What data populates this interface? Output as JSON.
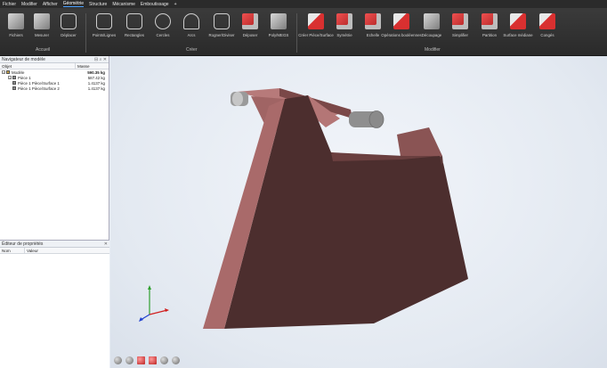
{
  "menu": {
    "items": [
      "Fichier",
      "Modifier",
      "Afficher",
      "Géométrie",
      "Structure",
      "Mécanisme",
      "Emboutissage",
      "+"
    ],
    "active": "Géométrie"
  },
  "ribbon": {
    "groups": {
      "accueil": "Accueil",
      "creer": "Créer",
      "modifier": "Modifier"
    },
    "buttons": [
      {
        "label": "Fichiers",
        "icon": "files-icon"
      },
      {
        "label": "Mesurer",
        "icon": "measure-icon"
      },
      {
        "label": "Déplacer",
        "icon": "move-icon"
      },
      {
        "label": "Points/Lignes",
        "icon": "points-lines-icon"
      },
      {
        "label": "Rectangles",
        "icon": "rectangles-icon"
      },
      {
        "label": "Cercles",
        "icon": "circles-icon"
      },
      {
        "label": "Arcs",
        "icon": "arcs-icon"
      },
      {
        "label": "Rogner/Diviser",
        "icon": "trim-split-icon"
      },
      {
        "label": "Déposer",
        "icon": "deposit-icon"
      },
      {
        "label": "Poly/MEGS",
        "icon": "poly-icon"
      },
      {
        "label": "Créer Pièce/Surface",
        "icon": "create-part-icon"
      },
      {
        "label": "Symétrie",
        "icon": "symmetry-icon"
      },
      {
        "label": "Echelle",
        "icon": "scale-icon"
      },
      {
        "label": "Opérations booléennes",
        "icon": "boolean-icon"
      },
      {
        "label": "Découpage",
        "icon": "cut-icon"
      },
      {
        "label": "Simplifier",
        "icon": "simplify-icon"
      },
      {
        "label": "Partition",
        "icon": "partition-icon"
      },
      {
        "label": "Surface médiane",
        "icon": "midsurface-icon"
      },
      {
        "label": "Congés",
        "icon": "fillets-icon"
      }
    ]
  },
  "model_browser": {
    "title": "Navigateur de modèle",
    "col_object": "Objet",
    "col_mass": "Masse",
    "rows": [
      {
        "name": "Modèle",
        "mass": "590.35 kg"
      },
      {
        "name": "Pièce 1",
        "mass": "587.42 kg"
      },
      {
        "name": "Pièce 1 Pièce/Surface 1",
        "mass": "1.4137 kg"
      },
      {
        "name": "Pièce 1 Pièce/Surface 2",
        "mass": "1.4137 kg"
      }
    ]
  },
  "properties": {
    "title": "Éditeur de propriétés",
    "col_name": "Nom",
    "col_value": "Valeur"
  },
  "colors": {
    "part_front": "#4c2e2e",
    "part_side": "#a96a6a",
    "part_top": "#b77a7a",
    "cylinder": "#9a9a9a"
  }
}
